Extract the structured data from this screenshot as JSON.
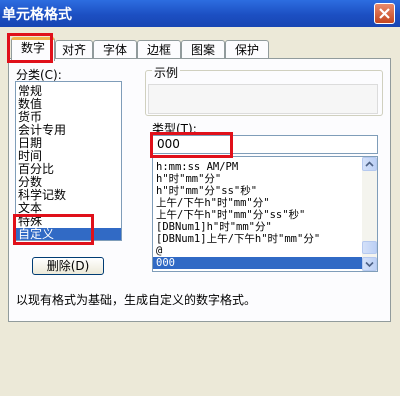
{
  "window": {
    "title": "单元格格式"
  },
  "tabs": [
    {
      "label": "数字"
    },
    {
      "label": "对齐"
    },
    {
      "label": "字体"
    },
    {
      "label": "边框"
    },
    {
      "label": "图案"
    },
    {
      "label": "保护"
    }
  ],
  "category": {
    "label": "分类(C):",
    "items": [
      "常规",
      "数值",
      "货币",
      "会计专用",
      "日期",
      "时间",
      "百分比",
      "分数",
      "科学记数",
      "文本",
      "特殊",
      "自定义"
    ],
    "selected": "自定义"
  },
  "sample": {
    "label": "示例",
    "value": ""
  },
  "type": {
    "label": "类型(T):",
    "value": "000",
    "options": [
      "h:mm:ss AM/PM",
      "h\"时\"mm\"分\"",
      "h\"时\"mm\"分\"ss\"秒\"",
      "上午/下午h\"时\"mm\"分\"",
      "上午/下午h\"时\"mm\"分\"ss\"秒\"",
      "[DBNum1]h\"时\"mm\"分\"",
      "[DBNum1]上午/下午h\"时\"mm\"分\"",
      "@",
      "000"
    ],
    "selected": "000"
  },
  "delete_button": {
    "label": "删除(D)"
  },
  "description": "以现有格式为基础，生成自定义的数字格式。",
  "colors": {
    "highlight": "#e0101a",
    "selection": "#316ac5",
    "titlebar": "#1c4fc2"
  }
}
